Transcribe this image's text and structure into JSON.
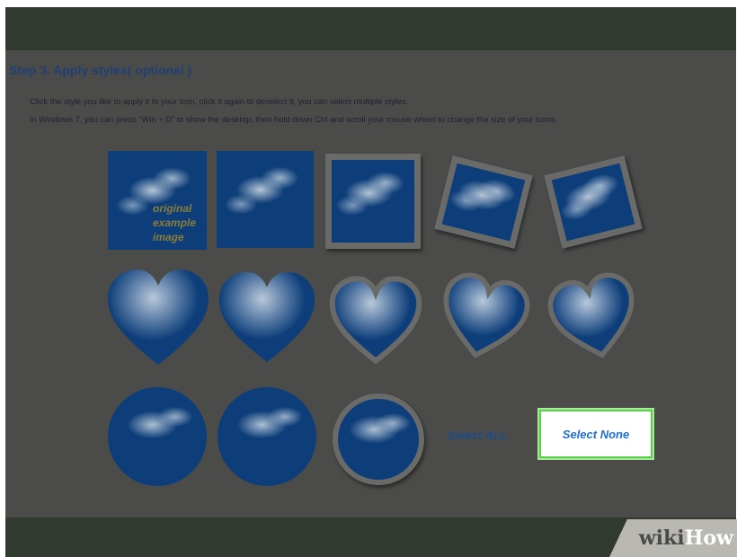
{
  "step_title": "Step 3. Apply styles( optional )",
  "instructions": {
    "line1": "Click the style you like to apply it to your icon, click it again to deselect it, you can select multiple styles.",
    "line2": "In Windows 7, you can press \"Win + D\" to show the desktop, then hold down Ctrl and scroll your mouse wheel to change the size of your icons."
  },
  "original_overlay": {
    "line1": "original",
    "line2": "example",
    "line3": "image"
  },
  "buttons": {
    "select_all": "Select ALL",
    "select_none": "Select None"
  },
  "watermark": {
    "part1": "wiki",
    "part2": "How"
  },
  "colors": {
    "highlight_border": "#58d04a",
    "select_none_text": "#1e6fd8",
    "title_color": "#203f73"
  }
}
